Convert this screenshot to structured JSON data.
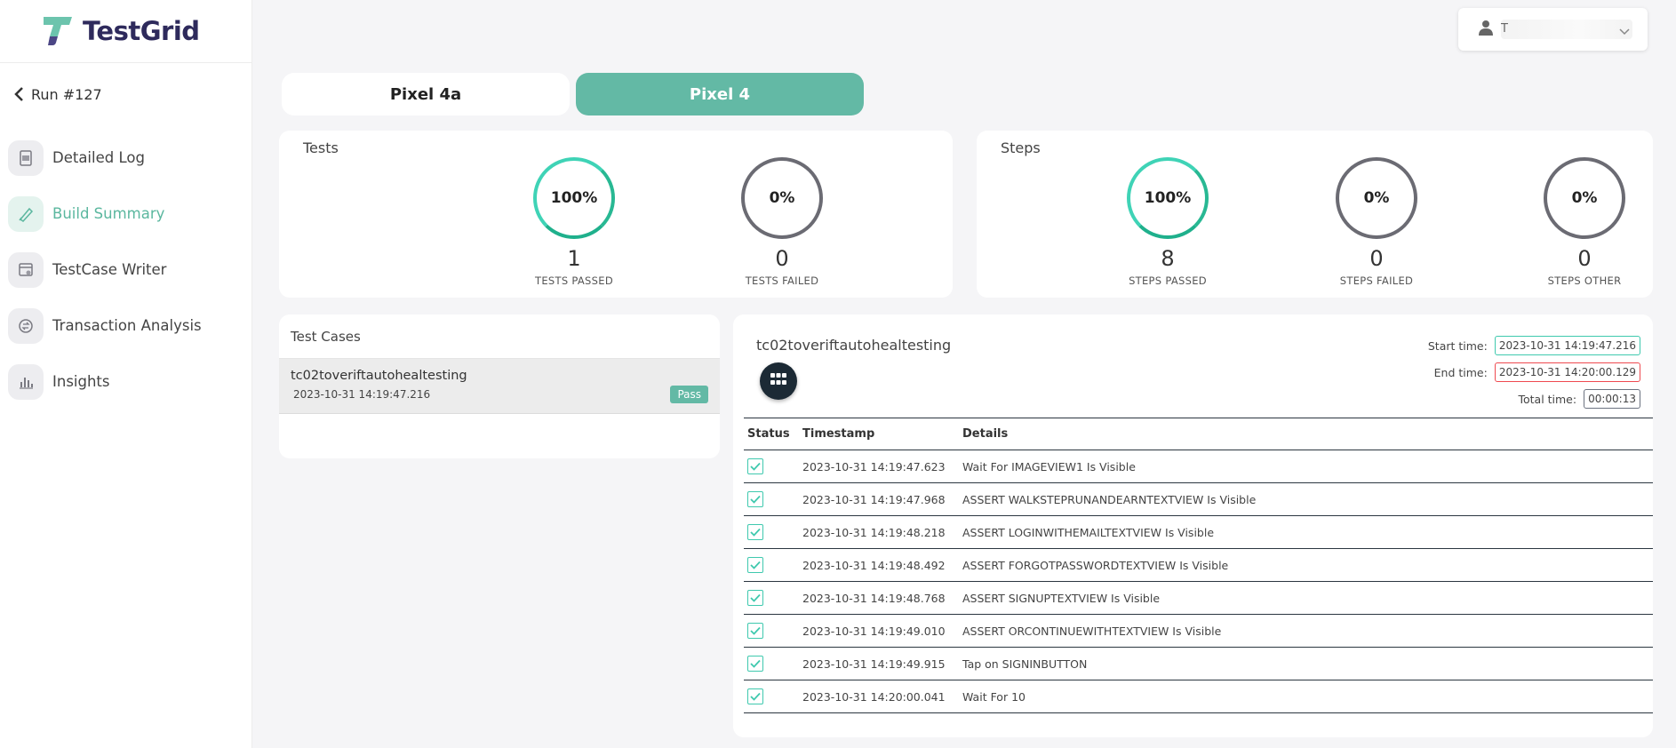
{
  "app": {
    "name": "TestGrid"
  },
  "sidebar": {
    "back_label": "Run #127",
    "items": [
      {
        "label": "Detailed Log",
        "icon": "document-icon",
        "active": false
      },
      {
        "label": "Build Summary",
        "icon": "build-icon",
        "active": true
      },
      {
        "label": "TestCase Writer",
        "icon": "testcase-writer-icon",
        "active": false
      },
      {
        "label": "Transaction Analysis",
        "icon": "transaction-icon",
        "active": false
      },
      {
        "label": "Insights",
        "icon": "insights-chart-icon",
        "active": false
      }
    ]
  },
  "user": {
    "name": "T"
  },
  "device_tabs": [
    {
      "label": "Pixel 4a",
      "active": false
    },
    {
      "label": "Pixel 4",
      "active": true
    }
  ],
  "tests_summary": {
    "title": "Tests",
    "metrics": [
      {
        "percent": "100%",
        "count": "1",
        "label": "TESTS PASSED",
        "color": "#3fd3b6"
      },
      {
        "percent": "0%",
        "count": "0",
        "label": "TESTS FAILED",
        "color": "#6b6b73"
      }
    ]
  },
  "steps_summary": {
    "title": "Steps",
    "metrics": [
      {
        "percent": "100%",
        "count": "8",
        "label": "STEPS PASSED",
        "color": "#3fd3b6"
      },
      {
        "percent": "0%",
        "count": "0",
        "label": "STEPS FAILED",
        "color": "#6b6b73"
      },
      {
        "percent": "0%",
        "count": "0",
        "label": "STEPS OTHER",
        "color": "#6b6b73"
      }
    ]
  },
  "test_cases": {
    "title": "Test Cases",
    "items": [
      {
        "name": "tc02toveriftautohealtesting",
        "time": "2023-10-31 14:19:47.216",
        "status": "Pass"
      }
    ]
  },
  "detail": {
    "title": "tc02toveriftautohealtesting",
    "start_label": "Start time:",
    "start_value": "2023-10-31 14:19:47.216",
    "end_label": "End time:",
    "end_value": "2023-10-31 14:20:00.129",
    "total_label": "Total time:",
    "total_value": "00:00:13",
    "columns": [
      "Status",
      "Timestamp",
      "Details"
    ],
    "rows": [
      {
        "timestamp": "2023-10-31 14:19:47.623",
        "details": "Wait For IMAGEVIEW1 Is Visible"
      },
      {
        "timestamp": "2023-10-31 14:19:47.968",
        "details": "ASSERT WALKSTEPRUNANDEARNTEXTVIEW Is Visible"
      },
      {
        "timestamp": "2023-10-31 14:19:48.218",
        "details": "ASSERT LOGINWITHEMAILTEXTVIEW Is Visible"
      },
      {
        "timestamp": "2023-10-31 14:19:48.492",
        "details": "ASSERT FORGOTPASSWORDTEXTVIEW Is Visible"
      },
      {
        "timestamp": "2023-10-31 14:19:48.768",
        "details": "ASSERT SIGNUPTEXTVIEW Is Visible"
      },
      {
        "timestamp": "2023-10-31 14:19:49.010",
        "details": "ASSERT ORCONTINUEWITHTEXTVIEW Is Visible"
      },
      {
        "timestamp": "2023-10-31 14:19:49.915",
        "details": "Tap on SIGNINBUTTON"
      },
      {
        "timestamp": "2023-10-31 14:20:00.041",
        "details": "Wait For 10"
      }
    ]
  }
}
